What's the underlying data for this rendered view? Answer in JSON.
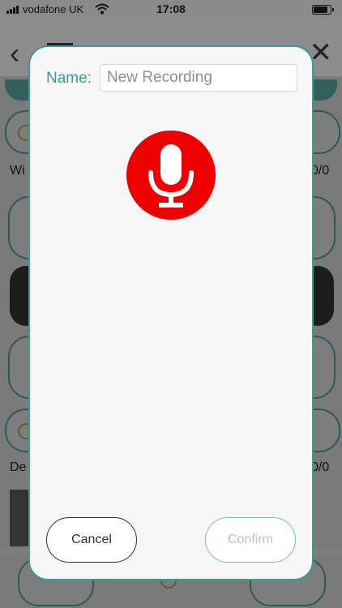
{
  "status_bar": {
    "carrier": "vodafone UK",
    "time": "17:08"
  },
  "background": {
    "label_left_1": "Wi",
    "label_right_1": "0/0",
    "label_left_2": "De",
    "label_right_2": "0/0"
  },
  "dialog": {
    "name_label": "Name:",
    "name_placeholder": "New Recording",
    "name_value": "",
    "cancel_label": "Cancel",
    "confirm_label": "Confirm",
    "mic_color": "#ee0000",
    "accent_color": "#3b9d97"
  },
  "icons": {
    "mic": "microphone-icon",
    "signal": "cellular-signal-icon",
    "wifi": "wifi-icon",
    "battery": "battery-icon"
  }
}
